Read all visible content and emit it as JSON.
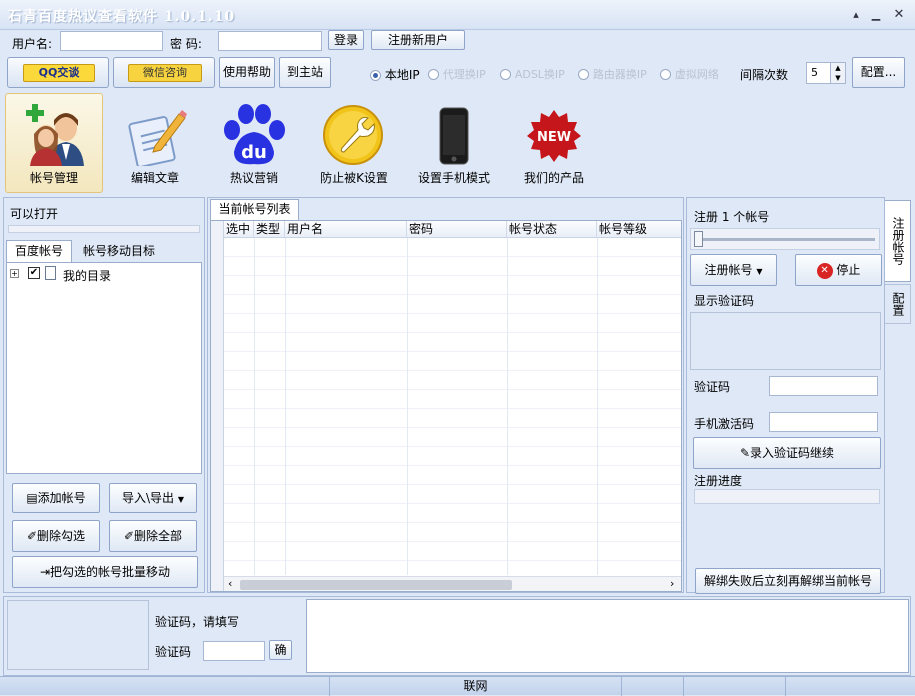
{
  "window": {
    "title": "石青百度热议查看软件 1.0.1.10"
  },
  "login": {
    "username_label": "用户名:",
    "password_label": "密  码:",
    "login_button": "登录",
    "register_button": "注册新用户"
  },
  "toolbar": {
    "qq": "QQ交谈",
    "wechat": "微信咨询",
    "help": "使用帮助",
    "home": "到主站",
    "radios": [
      {
        "label": "本地IP",
        "checked": true,
        "enabled": true
      },
      {
        "label": "代理换IP",
        "checked": false,
        "enabled": false
      },
      {
        "label": "ADSL换IP",
        "checked": false,
        "enabled": false
      },
      {
        "label": "路由器换IP",
        "checked": false,
        "enabled": false
      },
      {
        "label": "虚拟网络",
        "checked": false,
        "enabled": false
      }
    ],
    "interval_label": "间隔次数",
    "interval_value": "5",
    "config": "配置..."
  },
  "modules": [
    {
      "label": "帐号管理",
      "icon": "users-icon"
    },
    {
      "label": "编辑文章",
      "icon": "edit-document-icon"
    },
    {
      "label": "热议营销",
      "icon": "baidu-paw-icon"
    },
    {
      "label": "防止被K设置",
      "icon": "wrench-icon"
    },
    {
      "label": "设置手机模式",
      "icon": "phone-icon"
    },
    {
      "label": "我们的产品",
      "icon": "new-badge-icon"
    }
  ],
  "left": {
    "can_open": "可以打开",
    "tabs": [
      "百度帐号",
      "帐号移动目标"
    ],
    "tree_root": "我的目录",
    "buttons": {
      "add": "添加帐号",
      "import_export": "导入\\导出",
      "delete_checked": "删除勾选",
      "delete_all": "删除全部",
      "batch_move": "把勾选的帐号批量移动"
    }
  },
  "center": {
    "tab": "当前帐号列表",
    "columns": [
      "选中",
      "类型",
      "用户名",
      "密码",
      "帐号状态",
      "帐号等级"
    ]
  },
  "right": {
    "register_count": "注册 1 个帐号",
    "register_button": "注册帐号",
    "stop_button": "停止",
    "show_captcha": "显示验证码",
    "captcha_label": "验证码",
    "phone_code_label": "手机激活码",
    "submit_captcha": "录入验证码继续",
    "progress_label": "注册进度",
    "unbind_button": "解绑失败后立刻再解绑当前帐号",
    "side_tabs": [
      "注册帐号",
      "配置"
    ]
  },
  "bottom": {
    "captcha_prompt": "验证码，请填写",
    "captcha_label": "验证码",
    "confirm": "确"
  },
  "statusbar": {
    "network": "联网"
  }
}
